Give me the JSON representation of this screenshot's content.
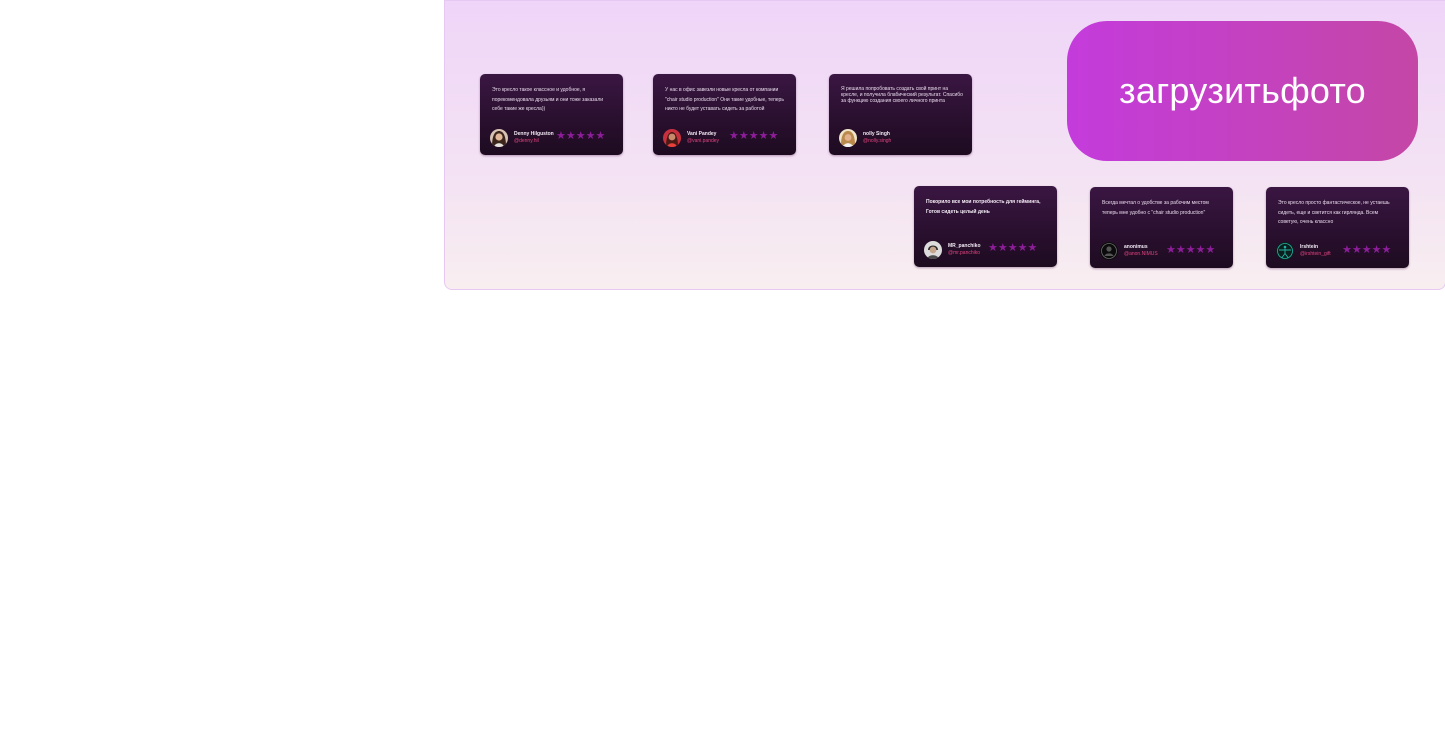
{
  "upload_button": {
    "label": "загрузитьфото"
  },
  "rating_stars": "★★★★★",
  "reviews": [
    {
      "text": "Это кресло такое классное и удобное, я порекомендовала друзьям и они тоже заказали себе такие же кресла))",
      "name": "Denny Hilguston",
      "handle": "@denny.hil",
      "rating": 5
    },
    {
      "text": "У нас в офис завезли новые кресла от компании \"chair studio production\" Они такие удобные, теперь никто не будет уставать сидеть за работой",
      "name": "Vani Pandey",
      "handle": "@vani.pandey",
      "rating": 5
    },
    {
      "text": "Я решила попробовать создать свой принт на кресле, и получила блабический результат. Спасибо за функцию создания своего личного принта",
      "name": "nolly Singh",
      "handle": "@nolly.singh",
      "rating": 5
    },
    {
      "text": "Покорило все мои потребность для гейминга, Готов сидеть целый день",
      "name": "MR_panchiko",
      "handle": "@mr.panchiko",
      "rating": 5
    },
    {
      "text": "Всегда мечтал о удобстве за рабочим местом теперь мне удобно с \"chair studio production\"",
      "name": "anonimus",
      "handle": "@anon.NIMUS",
      "rating": 5
    },
    {
      "text": "Это кресло просто фантастическое, не устаешь сидеть, еще и светится как гирлянда. Всем советую, очень классно",
      "name": "Irshtein",
      "handle": "@irshtein_gift",
      "rating": 5
    }
  ]
}
